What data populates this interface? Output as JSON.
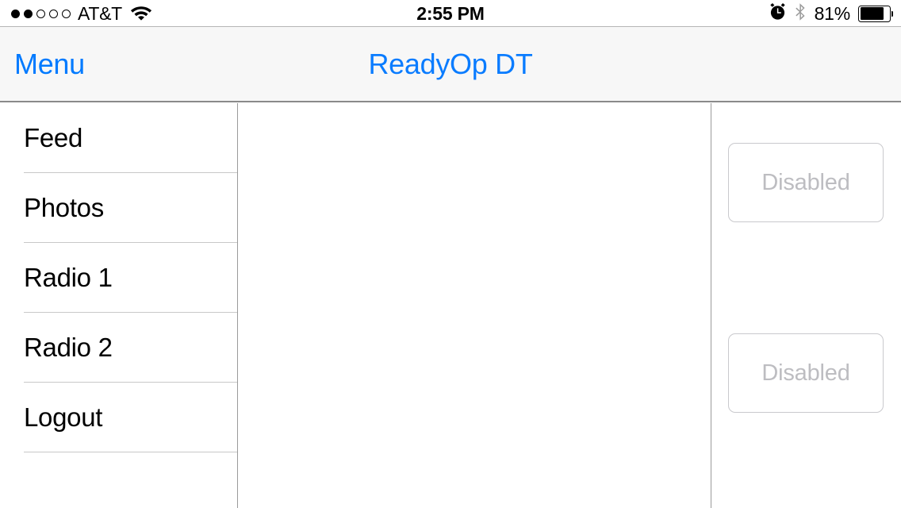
{
  "status_bar": {
    "carrier": "AT&T",
    "signal_bars_filled": 2,
    "signal_bars_total": 5,
    "wifi_icon": "wifi-icon",
    "time": "2:55 PM",
    "alarm_icon": "alarm-clock-icon",
    "bluetooth_icon": "bluetooth-icon",
    "battery_percent_label": "81%",
    "battery_level": 81
  },
  "nav_bar": {
    "menu_label": "Menu",
    "title": "ReadyOp DT",
    "tint_color": "#007AFF"
  },
  "sidebar": {
    "items": [
      {
        "label": "Feed"
      },
      {
        "label": "Photos"
      },
      {
        "label": "Radio 1"
      },
      {
        "label": "Radio 2"
      },
      {
        "label": "Logout"
      }
    ]
  },
  "center_panel": {
    "content": ""
  },
  "right_panel": {
    "buttons": [
      {
        "label": "Disabled",
        "enabled": false
      },
      {
        "label": "Disabled",
        "enabled": false
      }
    ],
    "disabled_text_color": "#BDBDC1",
    "disabled_border_color": "#C9C9CD"
  }
}
